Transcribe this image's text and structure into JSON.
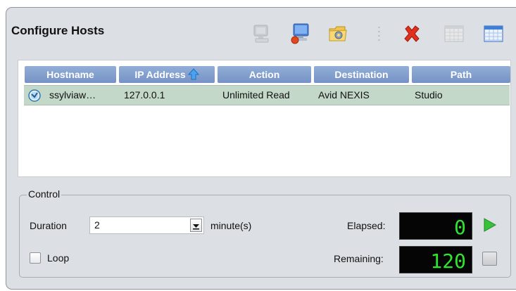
{
  "panel": {
    "title": "Configure Hosts"
  },
  "toolbar": {
    "items": [
      {
        "icon": "host-monitor-disabled-icon",
        "enabled": false
      },
      {
        "icon": "add-host-icon",
        "enabled": true
      },
      {
        "icon": "folder-settings-icon",
        "enabled": true
      },
      {
        "icon": "delete-icon",
        "enabled": true
      },
      {
        "icon": "grid-view-disabled-icon",
        "enabled": false
      },
      {
        "icon": "grid-view-icon",
        "enabled": true
      }
    ]
  },
  "table": {
    "columns": [
      "Hostname",
      "IP Address",
      "Action",
      "Destination",
      "Path"
    ],
    "sorted_column": "IP Address",
    "sort_direction": "ascending",
    "rows": [
      {
        "hostname": "ssylviaw…",
        "ip": "127.0.0.1",
        "action": "Unlimited Read",
        "destination": "Avid NEXIS",
        "path": "Studio",
        "selected": true
      }
    ]
  },
  "control": {
    "group_label": "Control",
    "duration_label": "Duration",
    "duration_value": "2",
    "duration_unit": "minute(s)",
    "loop_label": "Loop",
    "loop_checked": false,
    "elapsed_label": "Elapsed:",
    "elapsed_value": "0",
    "remaining_label": "Remaining:",
    "remaining_value": "120"
  },
  "colors": {
    "header": "#7f9bcc",
    "selected_row": "#c3d8c9",
    "lcd_digits": "#2ee62e"
  }
}
